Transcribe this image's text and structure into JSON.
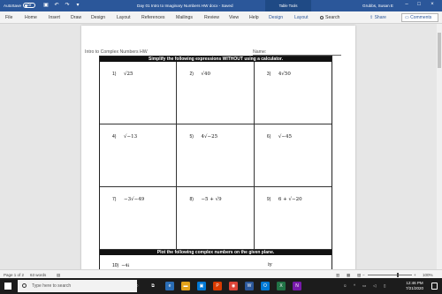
{
  "titlebar": {
    "autosave_label": "AutoSave",
    "autosave_state": "Off",
    "doc_title": "Day 01 Intro to Imaginary Numbers HW docx  -  Saved",
    "table_tools": "Table Tools",
    "user": "Grubbs, Susan E",
    "color": "#2b579a"
  },
  "ribbon": {
    "tabs": [
      "File",
      "Home",
      "Insert",
      "Draw",
      "Design",
      "Layout",
      "References",
      "Mailings",
      "Review",
      "View",
      "Help",
      "Design",
      "Layout"
    ],
    "search_label": "Search",
    "share_label": "Share",
    "comments_label": "Comments"
  },
  "document": {
    "header_left": "Intro to Complex Numbers HW",
    "header_right": "Name:",
    "section1_title": "Simplify the following expressions WITHOUT using a calculator.",
    "problems": [
      {
        "num": "1)",
        "expr": "√25"
      },
      {
        "num": "2)",
        "expr": "√40"
      },
      {
        "num": "3)",
        "expr": "4√50"
      },
      {
        "num": "4)",
        "expr": "√−13"
      },
      {
        "num": "5)",
        "expr": "4√−25"
      },
      {
        "num": "6)",
        "expr": "√−45"
      },
      {
        "num": "7)",
        "expr": "−3√−49"
      },
      {
        "num": "8)",
        "expr": "−5 + √9"
      },
      {
        "num": "9)",
        "expr": "6 + √−20"
      }
    ],
    "section2_title": "Plot the following complex numbers on the given plane.",
    "q10_num": "10)",
    "q10_expr": "−4i",
    "axis_label": "iy"
  },
  "statusbar": {
    "page": "Page 1 of 2",
    "words": "63 words",
    "zoom": "100%"
  },
  "taskbar": {
    "search_placeholder": "Type here to search",
    "time": "12:46 PM",
    "date": "7/21/2020"
  }
}
